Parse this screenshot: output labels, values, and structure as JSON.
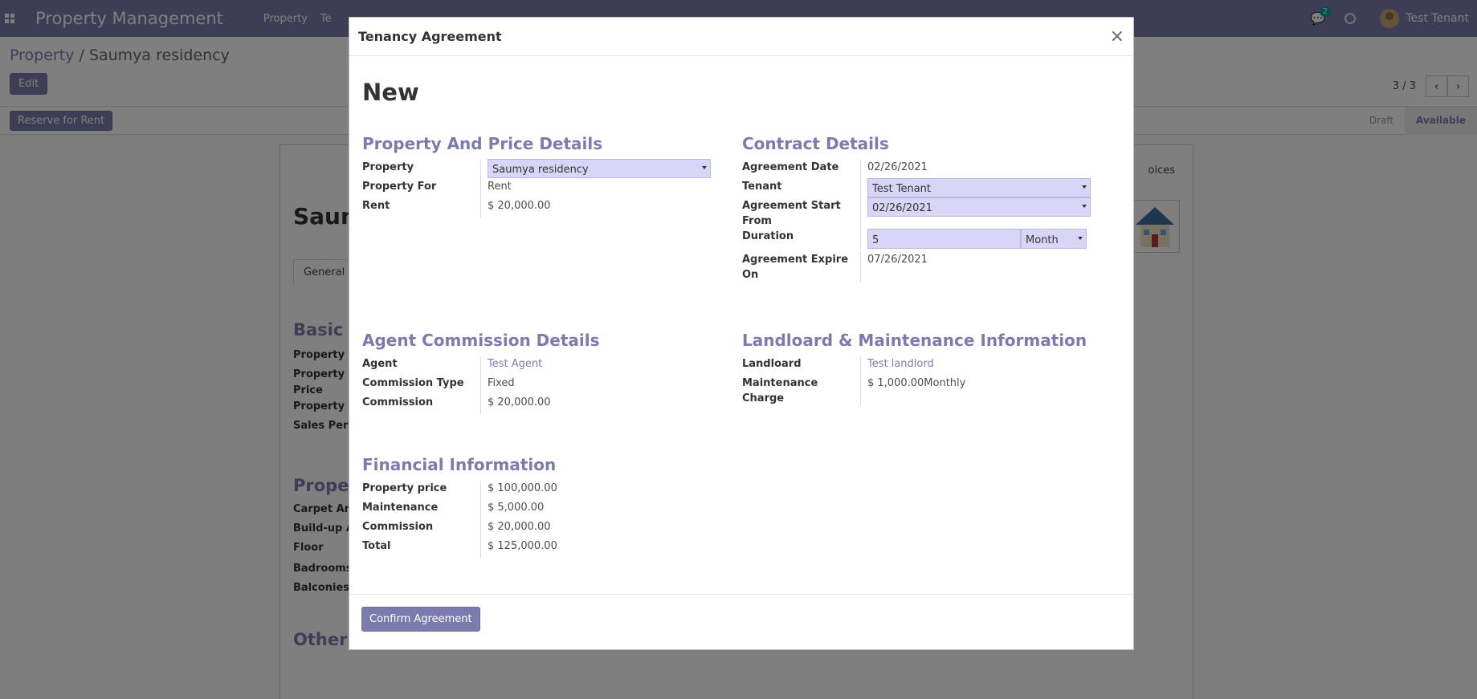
{
  "navbar": {
    "brand": "Property Management",
    "menu": [
      "Property",
      "Te"
    ],
    "chat_count": "2",
    "user_name": "Test Tenant"
  },
  "control_panel": {
    "breadcrumb_parent": "Property",
    "breadcrumb_sep": " / ",
    "breadcrumb_current": "Saumya residency",
    "edit_label": "Edit",
    "pager": "3 / 3",
    "reserve_label": "Reserve for Rent",
    "stages": [
      "Draft",
      "Available"
    ]
  },
  "sheet": {
    "title": "Saum",
    "tab": "General I",
    "invoices": "oices",
    "section_basic": "Basic I",
    "section_property": "Proper",
    "section_other": "Other",
    "basic_labels": [
      "Property I",
      "Property I",
      "Price",
      "Property S",
      "Sales Pers"
    ],
    "property_labels": [
      "Carpet Ar",
      "Build-up A",
      "Floor",
      "Badrooms",
      "Balconies"
    ]
  },
  "modal": {
    "title": "Tenancy Agreement",
    "close": "×",
    "doc_title": "New",
    "property_price": {
      "title": "Property And Price Details",
      "property_label": "Property",
      "property_value": "Saumya residency",
      "property_for_label": "Property For",
      "property_for_value": "Rent",
      "rent_label": "Rent",
      "rent_value": "$ 20,000.00"
    },
    "contract": {
      "title": "Contract Details",
      "agreement_date_label": "Agreement Date",
      "agreement_date_value": "02/26/2021",
      "tenant_label": "Tenant",
      "tenant_value": "Test Tenant",
      "start_label": "Agreement Start From",
      "start_value": "02/26/2021",
      "duration_label": "Duration",
      "duration_value": "5",
      "duration_unit": "Month",
      "expire_label": "Agreement Expire On",
      "expire_value": "07/26/2021"
    },
    "agent": {
      "title": "Agent Commission Details",
      "agent_label": "Agent",
      "agent_value": "Test Agent",
      "type_label": "Commission Type",
      "type_value": "Fixed",
      "commission_label": "Commission",
      "commission_value": "$ 20,000.00"
    },
    "landlord": {
      "title": "Landloard & Maintenance Information",
      "landlord_label": "Landloard",
      "landlord_value": "Test landlord",
      "maintenance_label": "Maintenance Charge",
      "maintenance_value": "$ 1,000.00Monthly"
    },
    "financial": {
      "title": "Financial Information",
      "price_label": "Property price",
      "price_value": "$ 100,000.00",
      "maintenance_label": "Maintenance",
      "maintenance_value": "$ 5,000.00",
      "commission_label": "Commission",
      "commission_value": "$ 20,000.00",
      "total_label": "Total",
      "total_value": "$ 125,000.00"
    },
    "confirm_label": "Confirm Agreement"
  },
  "colors": {
    "brand": "#7c7bad",
    "field_bg": "#d8d6f6"
  }
}
